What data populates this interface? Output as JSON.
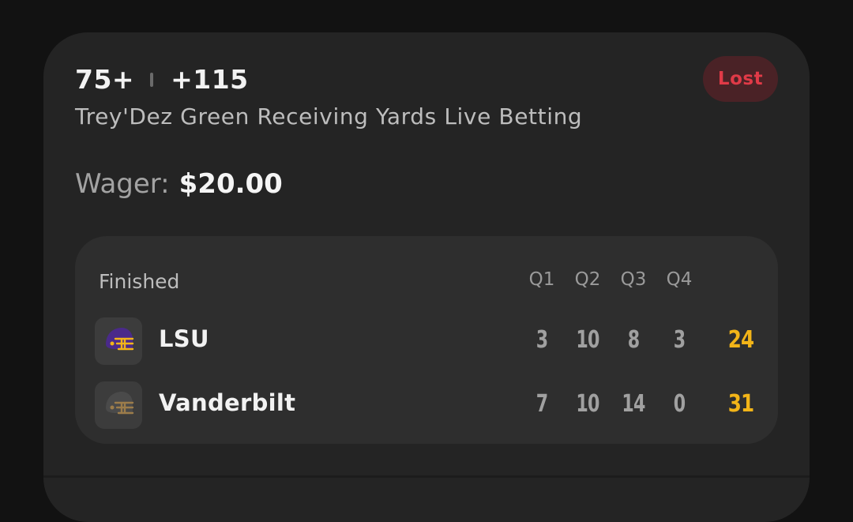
{
  "bet": {
    "line": "75+",
    "odds": "+115",
    "market": "Trey'Dez Green Receiving Yards Live Betting",
    "status": "Lost",
    "wager_label": "Wager:",
    "wager_amount": "$20.00"
  },
  "scoreboard": {
    "status": "Finished",
    "quarters": [
      "Q1",
      "Q2",
      "Q3",
      "Q4"
    ],
    "teams": [
      {
        "name": "LSU",
        "logo": "helmet-icon",
        "helmet_color": "#4a2a8a",
        "mask_color": "#f2b418",
        "quarters": [
          "3",
          "10",
          "8",
          "3"
        ],
        "total": "24"
      },
      {
        "name": "Vanderbilt",
        "logo": "helmet-icon",
        "helmet_color": "#4a4a4a",
        "mask_color": "#9c7c4a",
        "quarters": [
          "7",
          "10",
          "14",
          "0"
        ],
        "total": "31"
      }
    ]
  },
  "colors": {
    "background": "#121212",
    "card": "#242424",
    "scoreboard": "#2e2e2e",
    "lost_badge_bg": "#4a2226",
    "lost_badge_text": "#e03a47",
    "total_score": "#f2b418"
  }
}
